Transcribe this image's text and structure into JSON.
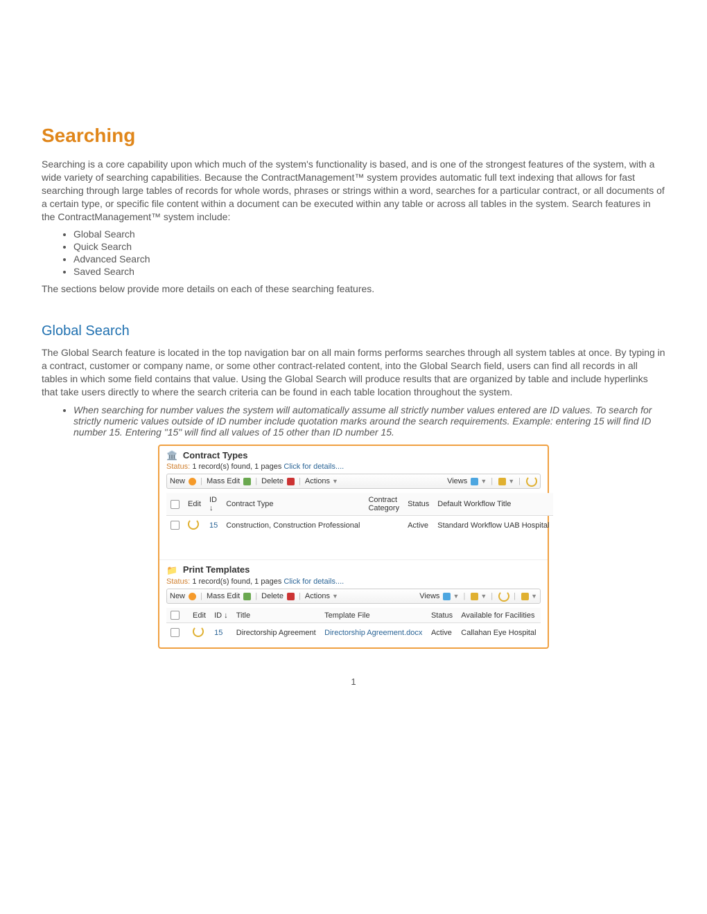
{
  "title": "Searching",
  "intro": "Searching is a core capability upon which much of the system's functionality is based, and is one of the strongest features of the system, with a wide variety of searching capabilities.  Because the ContractManagement™ system provides automatic full text indexing that allows for fast searching through large tables of records for whole words, phrases or strings within a word, searches for a particular contract, or all documents of a certain type, or specific file content within a document can be executed within any table or across all tables in the system.  Search features in the ContractManagement™ system include:",
  "features": [
    "Global Search",
    "Quick Search",
    "Advanced Search",
    "Saved Search"
  ],
  "intro_tail": "The sections below provide more details on each of these searching features.",
  "section_title": "Global Search",
  "section_body": "The Global Search feature is located in the top navigation bar on all main forms performs searches through all system tables at once.  By typing in a contract, customer or company name, or some other contract-related content, into the Global Search field, users can find all records in all tables in which some field contains that value.  Using the Global Search will produce results that are organized by table and include hyperlinks that take users directly to where the search criteria can be found in each table location throughout the system.",
  "note": "When searching for number values the system will automatically assume all strictly number values entered are ID values. To search for strictly numeric values outside of ID number include quotation marks around the search requirements. Example: entering 15 will find ID number 15. Entering \"15\" will find all values of 15 other than ID number 15.",
  "toolbar": {
    "new": "New",
    "mass_edit": "Mass Edit",
    "delete": "Delete",
    "actions": "Actions",
    "views": "Views"
  },
  "panel1": {
    "title": "Contract Types",
    "status_label": "Status:",
    "status_text": "1 record(s) found, 1 pages",
    "status_link": "Click for details....",
    "headers": {
      "edit": "Edit",
      "id": "ID ↓",
      "type": "Contract Type",
      "category": "Contract Category",
      "status": "Status",
      "workflow": "Default Workflow Title"
    },
    "row": {
      "id": "15",
      "type": "Construction, Construction Professional",
      "category": "",
      "status": "Active",
      "workflow": "Standard Workflow UAB Hospital"
    }
  },
  "panel2": {
    "title": "Print Templates",
    "status_label": "Status:",
    "status_text": "1 record(s) found, 1 pages",
    "status_link": "Click for details....",
    "headers": {
      "edit": "Edit",
      "id": "ID ↓",
      "title": "Title",
      "file": "Template File",
      "status": "Status",
      "avail": "Available for Facilities"
    },
    "row": {
      "id": "15",
      "title": "Directorship Agreement",
      "file": "Directorship Agreement.docx",
      "status": "Active",
      "avail": "Callahan Eye Hospital"
    }
  },
  "page_number": "1"
}
